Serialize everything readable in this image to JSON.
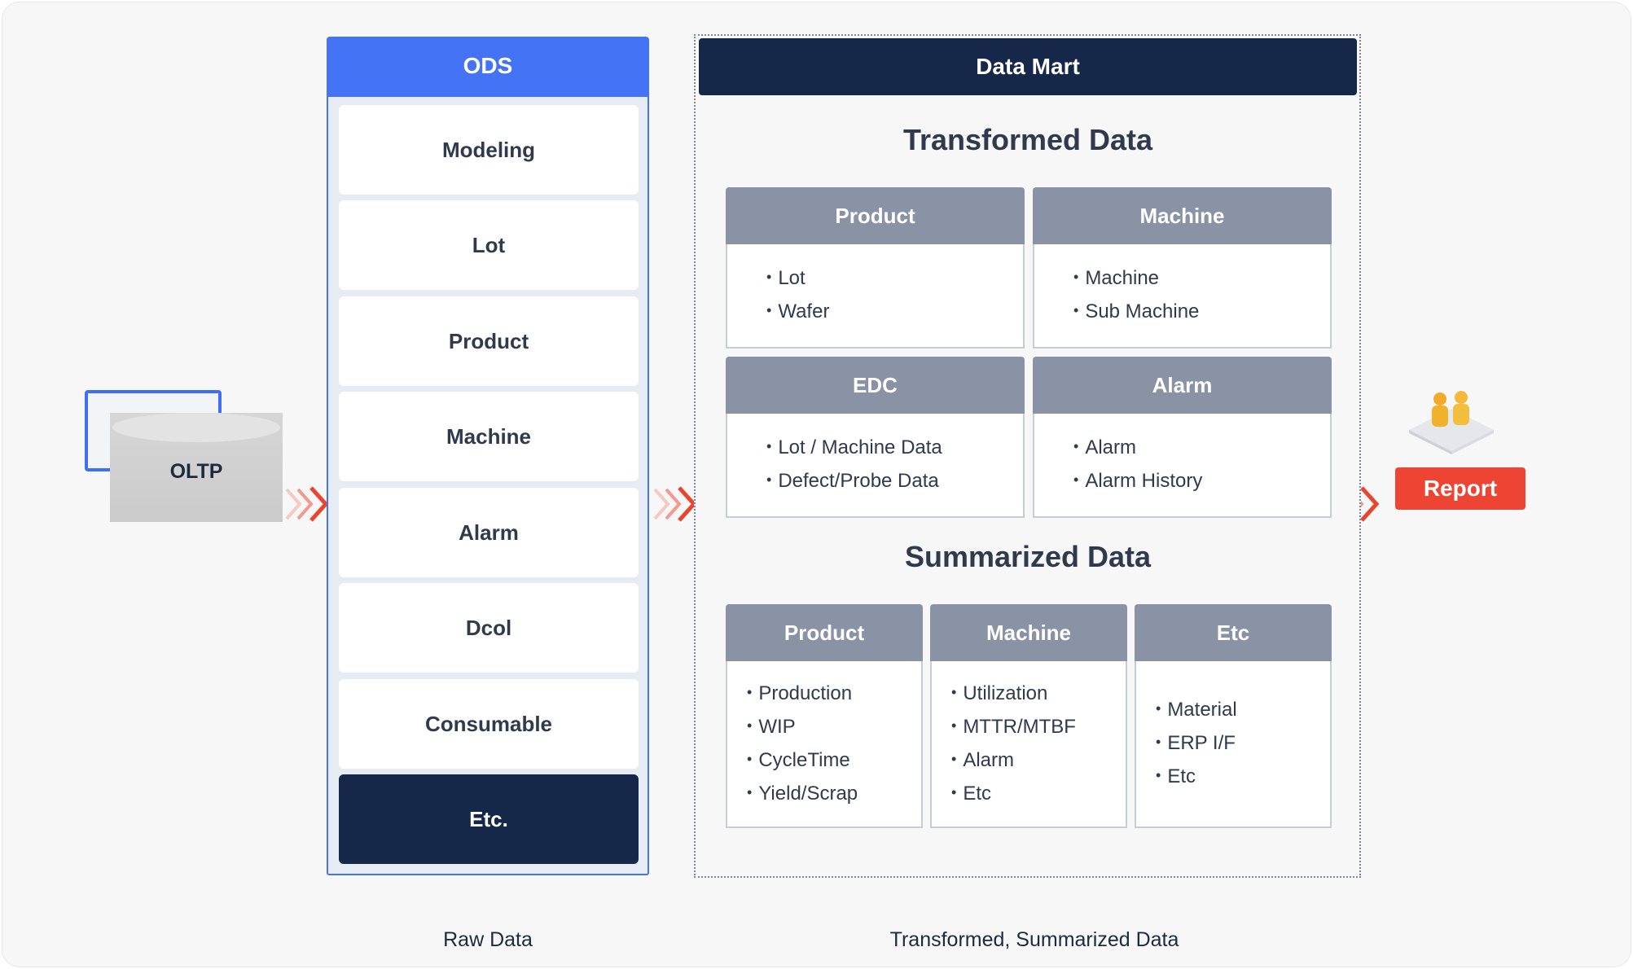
{
  "source": {
    "label": "OLTP"
  },
  "ods": {
    "title": "ODS",
    "items": [
      "Modeling",
      "Lot",
      "Product",
      "Machine",
      "Alarm",
      "Dcol",
      "Consumable",
      "Etc."
    ]
  },
  "data_mart": {
    "title": "Data Mart",
    "transformed": {
      "title": "Transformed Data",
      "cards": [
        {
          "title": "Product",
          "items": [
            "Lot",
            "Wafer"
          ]
        },
        {
          "title": "Machine",
          "items": [
            "Machine",
            "Sub Machine"
          ]
        },
        {
          "title": "EDC",
          "items": [
            "Lot / Machine Data",
            "Defect/Probe Data"
          ]
        },
        {
          "title": "Alarm",
          "items": [
            "Alarm",
            "Alarm History"
          ]
        }
      ]
    },
    "summarized": {
      "title": "Summarized Data",
      "cards": [
        {
          "title": "Product",
          "items": [
            "Production",
            "WIP",
            "CycleTime",
            "Yield/Scrap"
          ]
        },
        {
          "title": "Machine",
          "items": [
            "Utilization",
            "MTTR/MTBF",
            "Alarm",
            "Etc"
          ]
        },
        {
          "title": "Etc",
          "items": [
            "Material",
            "ERP I/F",
            "Etc"
          ]
        }
      ]
    }
  },
  "report": {
    "label": "Report",
    "icon": "users-icon"
  },
  "captions": {
    "raw": "Raw Data",
    "transformed": "Transformed, Summarized Data"
  },
  "colors": {
    "ods_blue": "#4573f6",
    "navy": "#15284a",
    "card_header": "#8a93a6",
    "report_red": "#ee4433",
    "arrow_red": "#e8442e"
  }
}
